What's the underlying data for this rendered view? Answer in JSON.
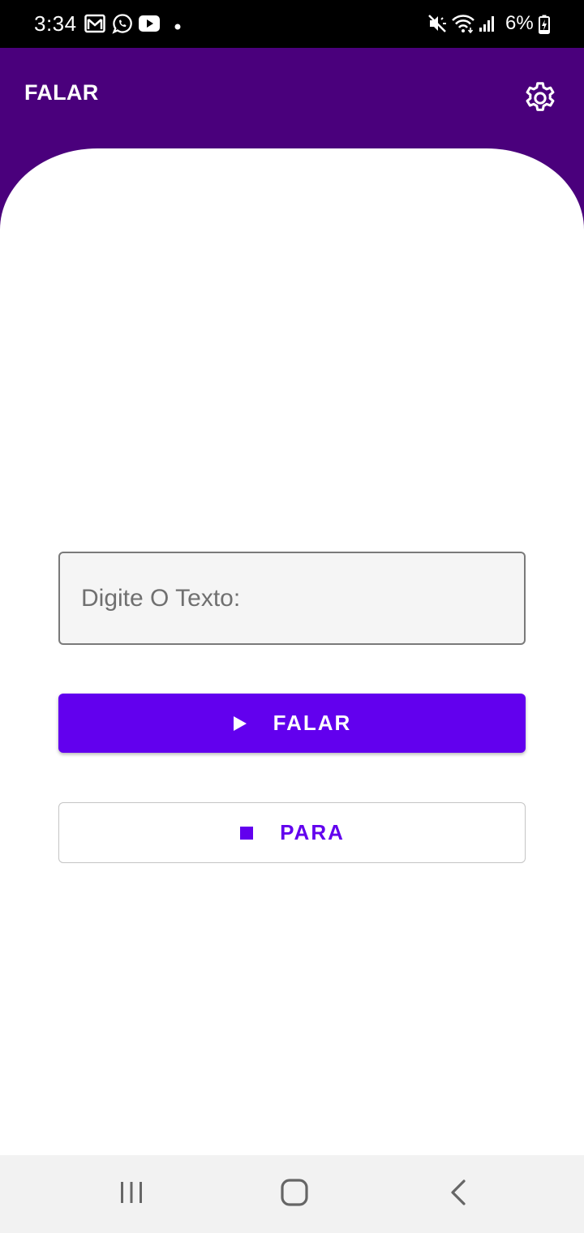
{
  "status_bar": {
    "time": "3:34",
    "battery_percent": "6%",
    "icons": [
      "gmail-icon",
      "whatsapp-icon",
      "youtube-icon",
      "dot-icon",
      "mute-icon",
      "wifi-icon",
      "signal-icon",
      "battery-charging-icon"
    ]
  },
  "app_bar": {
    "title": "FALAR",
    "settings_icon": "gear-icon",
    "background_color": "#4a007c"
  },
  "main": {
    "text_input": {
      "placeholder": "Digite O Texto:",
      "value": ""
    },
    "speak_button": {
      "label": "FALAR",
      "icon": "play-icon",
      "color": "#6200ee"
    },
    "stop_button": {
      "label": "PARA",
      "icon": "stop-icon",
      "color": "#6200ee"
    }
  },
  "nav_bar": {
    "items": [
      "recent-apps-icon",
      "home-icon",
      "back-icon"
    ]
  }
}
